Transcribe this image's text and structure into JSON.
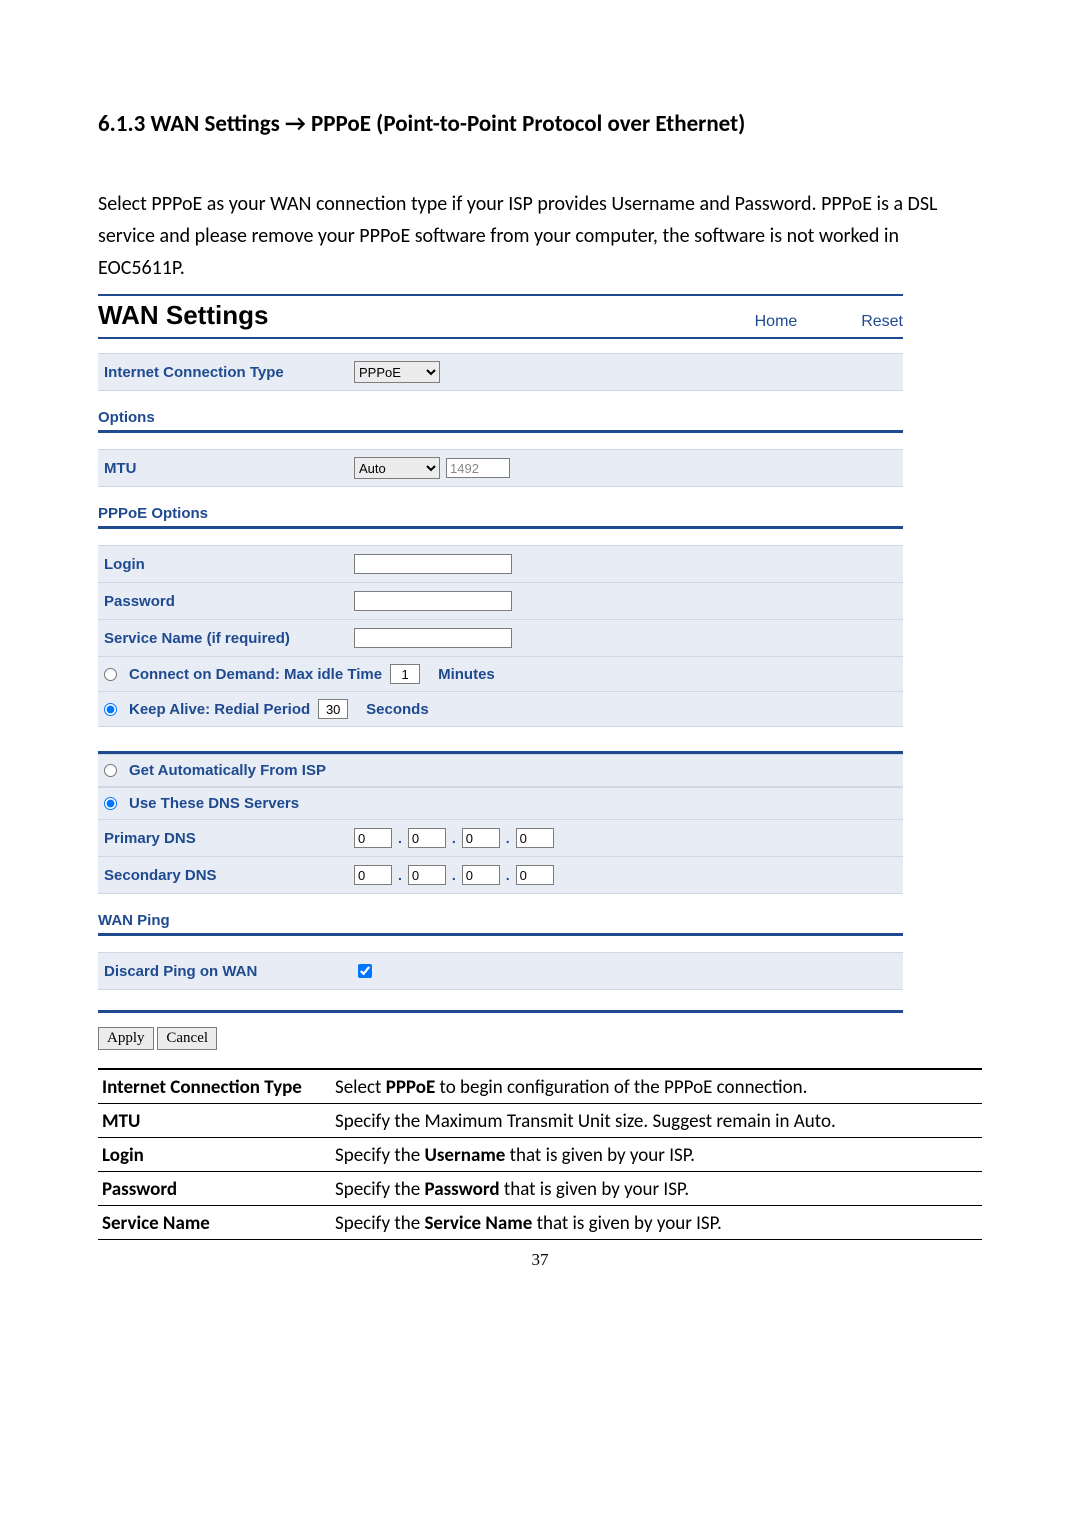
{
  "section_title": "6.1.3 WAN Settings → PPPoE (Point-to-Point Protocol over Ethernet)",
  "intro": "Select PPPoE as your WAN connection type if your ISP provides Username and Password. PPPoE is a DSL service and please remove your PPPoE software from your computer, the software is not worked in EOC5611P.",
  "panel": {
    "title": "WAN Settings",
    "nav_home": "Home",
    "nav_reset": "Reset",
    "conn_type_label": "Internet Connection Type",
    "conn_type_value": "PPPoE",
    "options_title": "Options",
    "mtu_label": "MTU",
    "mtu_mode": "Auto",
    "mtu_value": "1492",
    "pppoe_title": "PPPoE Options",
    "login_label": "Login",
    "password_label": "Password",
    "service_label": "Service Name (if required)",
    "connect_demand_label": "Connect on Demand: Max idle Time",
    "connect_demand_value": "1",
    "connect_demand_unit": "Minutes",
    "keep_alive_label": "Keep Alive: Redial Period",
    "keep_alive_value": "30",
    "keep_alive_unit": "Seconds",
    "dns_auto_label": "Get Automatically From ISP",
    "dns_use_label": "Use These DNS Servers",
    "primary_dns_label": "Primary DNS",
    "secondary_dns_label": "Secondary DNS",
    "dns_octet": "0",
    "wan_ping_title": "WAN Ping",
    "discard_ping_label": "Discard Ping on WAN",
    "apply": "Apply",
    "cancel": "Cancel"
  },
  "desc": [
    {
      "term": "Internet Connection Type",
      "text_pre": "Select ",
      "bold": "PPPoE",
      "text_post": " to begin configuration of the PPPoE connection."
    },
    {
      "term": "MTU",
      "text_pre": "Specify the Maximum Transmit Unit size. Suggest remain in Auto.",
      "bold": "",
      "text_post": ""
    },
    {
      "term": "Login",
      "text_pre": "Specify the ",
      "bold": "Username",
      "text_post": " that is given by your ISP."
    },
    {
      "term": "Password",
      "text_pre": "Specify the ",
      "bold": "Password",
      "text_post": " that is given by your ISP."
    },
    {
      "term": "Service Name",
      "text_pre": "Specify the ",
      "bold": "Service Name",
      "text_post": " that is given by your ISP."
    }
  ],
  "page_number": "37"
}
